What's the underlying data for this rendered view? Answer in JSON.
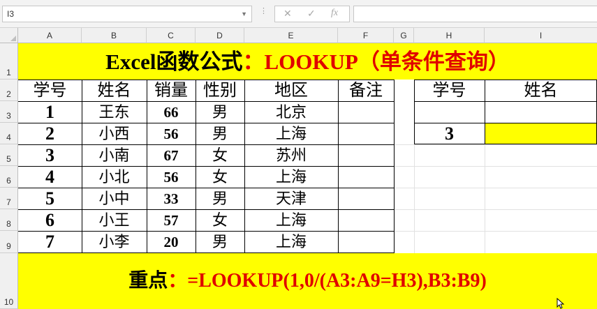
{
  "name_box": {
    "value": "I3",
    "arrow": "▼"
  },
  "toolbar": {
    "separator": "⋮",
    "cancel_icon": "✕",
    "enter_icon": "✓",
    "fx_label": "fx"
  },
  "formula_bar": {
    "value": ""
  },
  "columns": [
    "A",
    "B",
    "C",
    "D",
    "E",
    "F",
    "G",
    "H",
    "I"
  ],
  "rows": [
    "1",
    "2",
    "3",
    "4",
    "5",
    "6",
    "7",
    "8",
    "9",
    "10"
  ],
  "title": {
    "part1": "Excel函数公式",
    "part2": "：LOOKUP（单条件查询）"
  },
  "table": {
    "headers": [
      "学号",
      "姓名",
      "销量",
      "性别",
      "地区",
      "备注"
    ],
    "rows": [
      {
        "id": "1",
        "name": "王东",
        "sales": "66",
        "gender": "男",
        "region": "北京",
        "note": ""
      },
      {
        "id": "2",
        "name": "小西",
        "sales": "56",
        "gender": "男",
        "region": "上海",
        "note": ""
      },
      {
        "id": "3",
        "name": "小南",
        "sales": "67",
        "gender": "女",
        "region": "苏州",
        "note": ""
      },
      {
        "id": "4",
        "name": "小北",
        "sales": "56",
        "gender": "女",
        "region": "上海",
        "note": ""
      },
      {
        "id": "5",
        "name": "小中",
        "sales": "33",
        "gender": "男",
        "region": "天津",
        "note": ""
      },
      {
        "id": "6",
        "name": "小王",
        "sales": "57",
        "gender": "女",
        "region": "上海",
        "note": ""
      },
      {
        "id": "7",
        "name": "小李",
        "sales": "20",
        "gender": "男",
        "region": "上海",
        "note": ""
      }
    ]
  },
  "lookup": {
    "header_id": "学号",
    "header_name": "姓名",
    "value_id": "3",
    "value_name": ""
  },
  "footer": {
    "part1": "重点",
    "part2": "：=LOOKUP(1,0/(A3:A9=H3),B3:B9)"
  },
  "colors": {
    "highlight": "#ffff00",
    "accent": "#e00000"
  }
}
